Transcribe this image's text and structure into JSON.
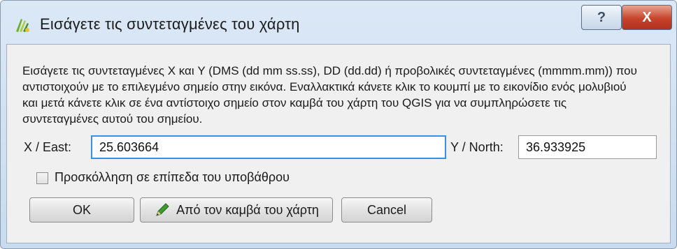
{
  "window": {
    "title": "Εισάγετε τις συντεταγμένες του χάρτη",
    "help_label": "?",
    "close_label": "X"
  },
  "description": "Εισάγετε τις συντεταγμένες X και Y (DMS (dd mm ss.ss), DD (dd.dd) ή προβολικές συντεταγμένες (mmmm.mm)) που αντιστοιχούν με το επιλεγμένο σημείο στην εικόνα. Εναλλακτικά κάνετε κλικ το κουμπί με το εικονίδιο ενός μολυβιού και μετά κάνετε κλικ σε ένα αντίστοιχο σημείο στον καμβά του χάρτη του QGIS για να συμπληρώσετε τις συντεταγμένες αυτού του σημείου.",
  "fields": {
    "x_label": "X / East:",
    "x_value": "25.603664",
    "y_label": "Y / North:",
    "y_value": "36.933925"
  },
  "snap_checkbox": {
    "label": "Προσκόλληση σε επίπεδα του υποβάθρου",
    "checked": false
  },
  "buttons": {
    "ok": "OK",
    "from_canvas": "Από τον καμβά του χάρτη",
    "cancel": "Cancel"
  },
  "icons": {
    "app": "qgis-georeferencer-icon",
    "pencil": "pencil-icon"
  }
}
